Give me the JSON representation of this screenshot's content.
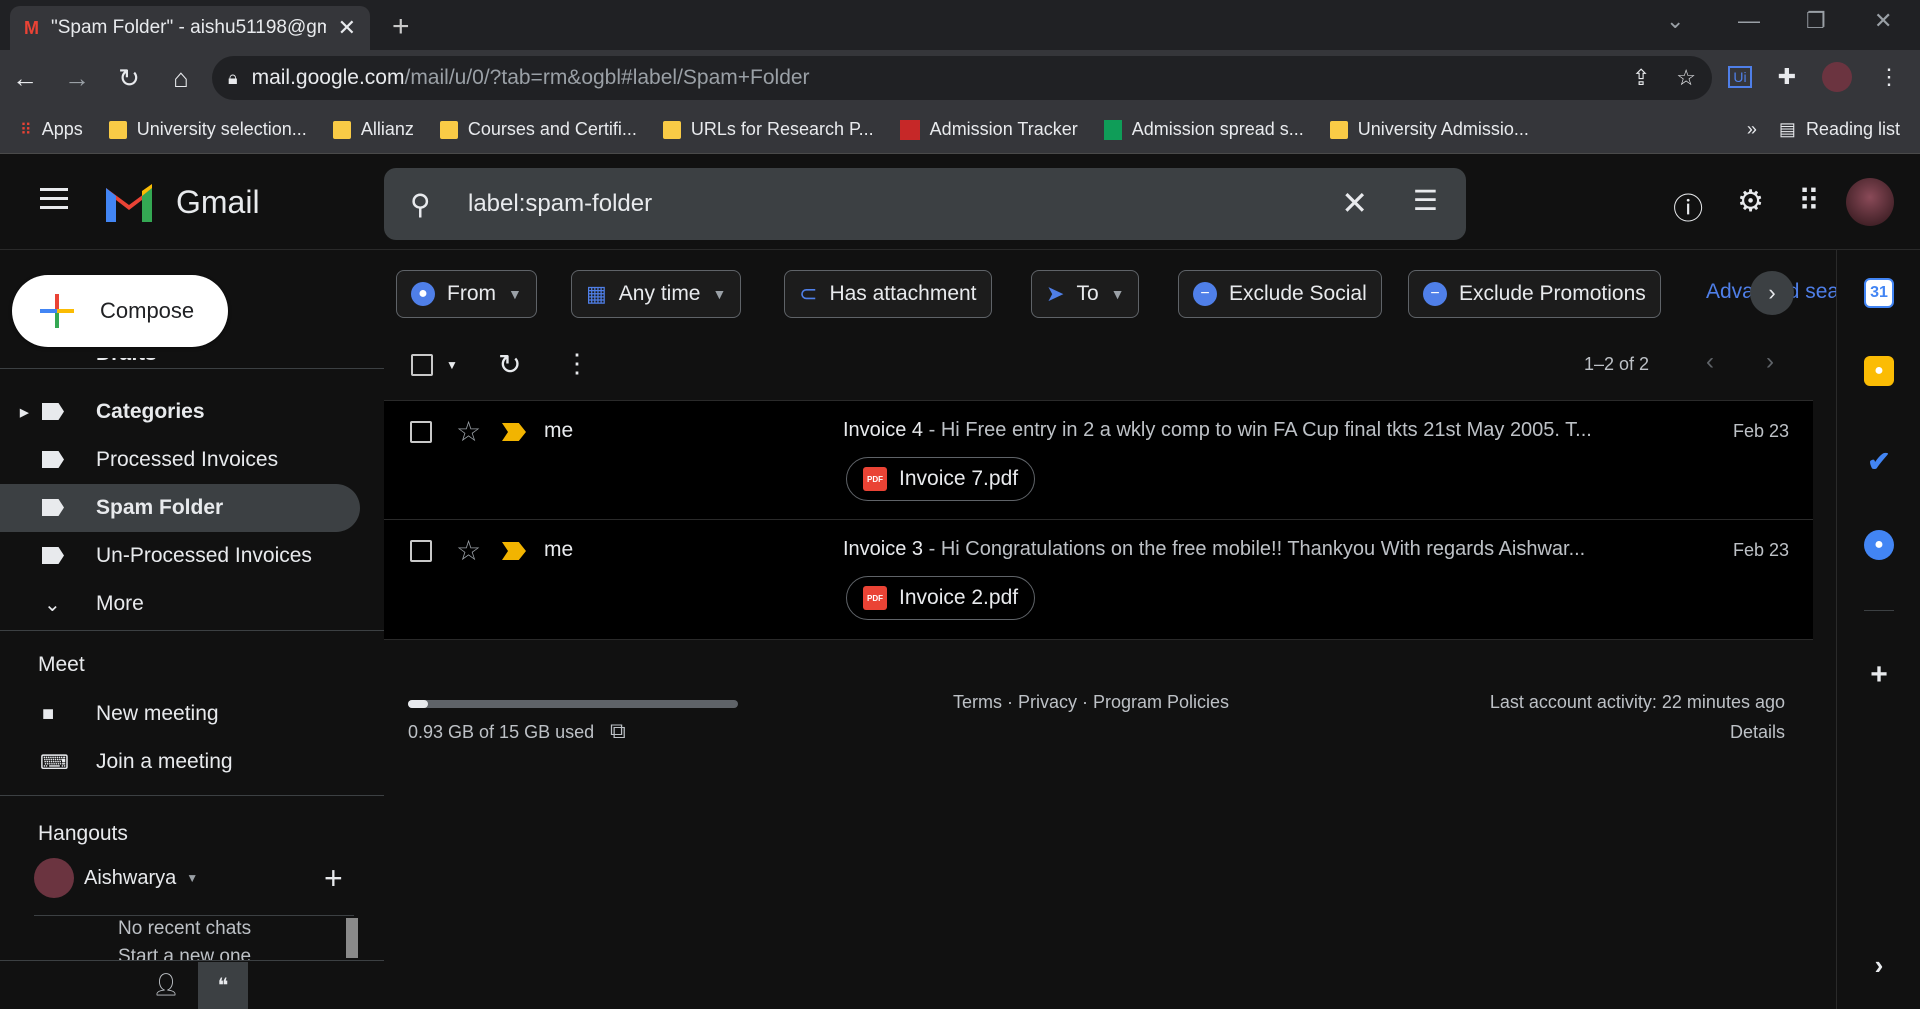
{
  "browser": {
    "tab_title": "\"Spam Folder\" - aishu51198@gm",
    "url_host": "mail.google.com",
    "url_path": "/mail/u/0/?tab=rm&ogbl#label/Spam+Folder",
    "bookmarks": [
      "Apps",
      "University selection...",
      "Allianz",
      "Courses and Certifi...",
      "URLs for Research P...",
      "Admission Tracker",
      "Admission spread s...",
      "University Admissio..."
    ],
    "reading_list": "Reading list",
    "more_bookmarks": "»"
  },
  "gmail": {
    "app_name": "Gmail",
    "search_query": "label:spam-folder",
    "compose_label": "Compose",
    "sidebar": {
      "partial_item": "Drafts",
      "items": [
        {
          "label": "Categories"
        },
        {
          "label": "Processed Invoices"
        },
        {
          "label": "Spam Folder"
        },
        {
          "label": "Un-Processed Invoices"
        },
        {
          "label": "More"
        }
      ],
      "meet_title": "Meet",
      "meet_items": [
        "New meeting",
        "Join a meeting"
      ],
      "hangouts_title": "Hangouts",
      "hangouts_user": "Aishwarya",
      "no_chats": "No recent chats",
      "start_chat": "Start a new one"
    },
    "filters": [
      "From",
      "Any time",
      "Has attachment",
      "To",
      "Exclude Social",
      "Exclude Promotions",
      "Advanced search"
    ],
    "pagination": "1–2 of 2",
    "emails": [
      {
        "sender": "me",
        "subject": "Invoice 4",
        "snippet": " - Hi Free entry in 2 a wkly comp to win FA Cup final tkts 21st May 2005. T...",
        "date": "Feb 23",
        "attachment": "Invoice 7.pdf"
      },
      {
        "sender": "me",
        "subject": "Invoice 3",
        "snippet": " - Hi Congratulations on the free mobile!! Thankyou With regards Aishwar...",
        "date": "Feb 23",
        "attachment": "Invoice 2.pdf"
      }
    ],
    "footer": {
      "storage_used_fraction": 0.062,
      "storage_text": "0.93 GB of 15 GB used",
      "links": "Terms · Privacy · Program Policies",
      "activity": "Last account activity: 22 minutes ago",
      "details": "Details"
    },
    "rail": {
      "calendar_day": "31"
    }
  },
  "colors": {
    "accent": "#4f7fe8",
    "important": "#f2b400",
    "bg": "#111111"
  }
}
